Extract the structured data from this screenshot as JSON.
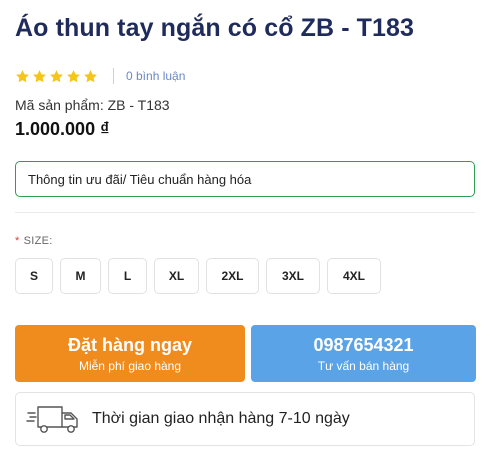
{
  "product": {
    "title": "Áo thun tay ngắn có cổ ZB - T183",
    "rating": {
      "stars": 5,
      "review_count_text": "0 bình luận"
    },
    "sku_text": "Mã sản phẩm: ZB - T183",
    "price": "1.000.000 ₫"
  },
  "promo": {
    "label": "Thông tin ưu đãi/ Tiêu chuẩn hàng hóa"
  },
  "size_selector": {
    "required_mark": "*",
    "label": "SIZE:",
    "options": [
      "S",
      "M",
      "L",
      "XL",
      "2XL",
      "3XL",
      "4XL"
    ]
  },
  "actions": {
    "order": {
      "title": "Đặt hàng ngay",
      "subtitle": "Miễn phí giao hàng",
      "color": "#f08c1d"
    },
    "hotline": {
      "title": "0987654321",
      "subtitle": "Tư vấn bán hàng",
      "color": "#5aa3e6"
    }
  },
  "delivery": {
    "icon": "truck-icon",
    "text": "Thời gian giao nhận hàng 7-10 ngày"
  },
  "colors": {
    "title": "#1f2b5b",
    "star": "#f5c518",
    "promo_border": "#2e9e55"
  }
}
